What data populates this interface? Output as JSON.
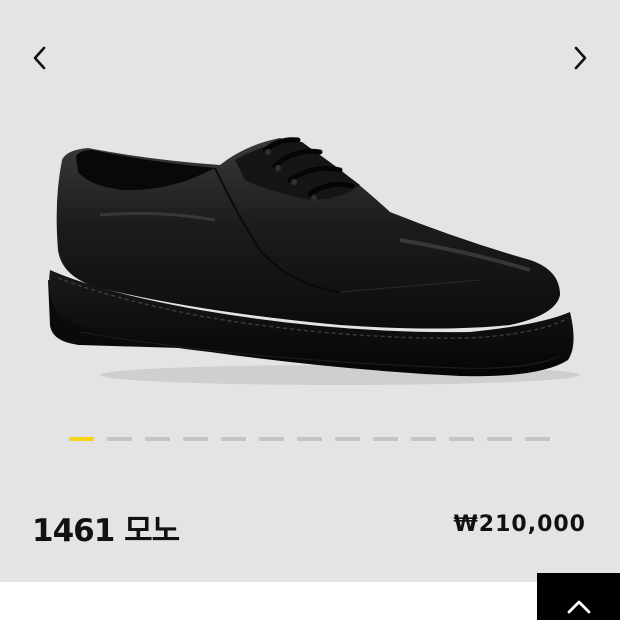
{
  "product": {
    "name": "1461 모노",
    "price": "₩210,000",
    "image_icon": "black-leather-derby-shoe"
  },
  "carousel": {
    "prev_icon": "chevron-left-icon",
    "next_icon": "chevron-right-icon",
    "slide_count": 13,
    "active_index": 0,
    "active_color": "#f7d417",
    "inactive_color": "#c4c4c4"
  },
  "scroll_top": {
    "icon": "chevron-up-icon"
  }
}
